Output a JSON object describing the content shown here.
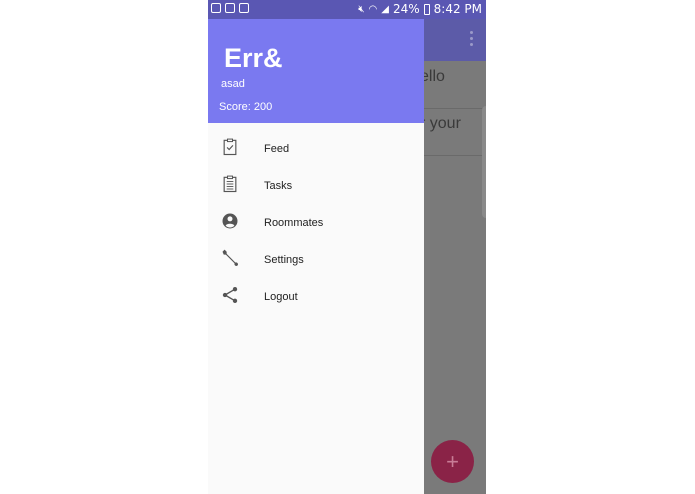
{
  "status_bar": {
    "battery_percent": "24%",
    "time": "8:42 PM",
    "left_icons": [
      "image-icon",
      "voicemail-icon",
      "bag-icon"
    ],
    "right_icons": [
      "mute-icon",
      "wifi-icon",
      "signal-icon",
      "battery-icon"
    ]
  },
  "colors": {
    "drawer_header": "#7a79f0",
    "status_bar": "#5a57b3",
    "fab": "#8a2347"
  },
  "drawer": {
    "app_name": "Err&",
    "user_name": "asad",
    "score": "Score: 200",
    "items": [
      {
        "label": "Feed",
        "icon": "clipboard-check-icon"
      },
      {
        "label": "Tasks",
        "icon": "clipboard-list-icon"
      },
      {
        "label": "Roommates",
        "icon": "account-circle-icon"
      },
      {
        "label": "Settings",
        "icon": "wrench-icon"
      },
      {
        "label": "Logout",
        "icon": "share-icon"
      }
    ]
  },
  "background_list": {
    "rows": [
      "ello",
      "r your"
    ]
  },
  "fab": {
    "symbol": "+"
  }
}
